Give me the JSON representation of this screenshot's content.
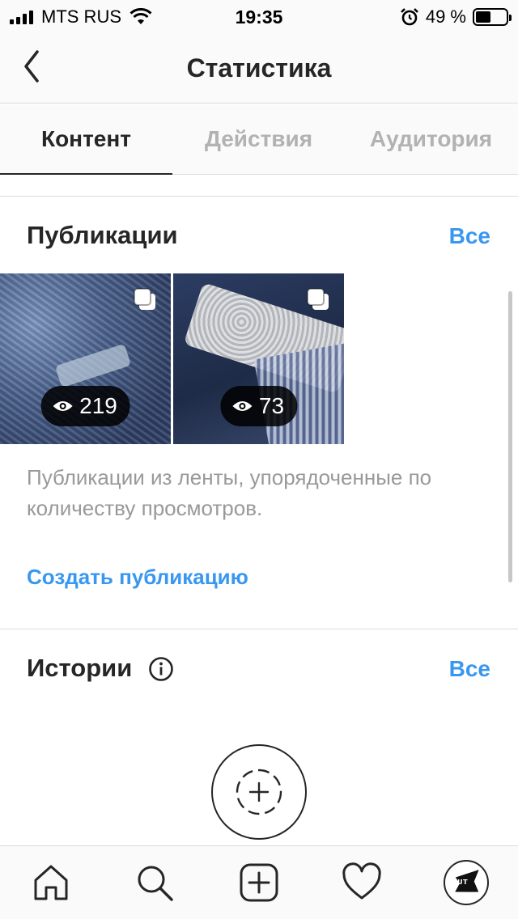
{
  "status_bar": {
    "carrier": "MTS RUS",
    "time": "19:35",
    "battery_percent": "49 %",
    "battery_level": 0.49
  },
  "nav": {
    "title": "Статистика",
    "back_icon": "chevron-left-icon"
  },
  "tabs": [
    {
      "label": "Контент",
      "active": true
    },
    {
      "label": "Действия",
      "active": false
    },
    {
      "label": "Аудитория",
      "active": false
    }
  ],
  "publications": {
    "title": "Публикации",
    "see_all": "Все",
    "posts": [
      {
        "views": "219",
        "type_icon": "carousel-icon"
      },
      {
        "views": "73",
        "type_icon": "carousel-icon"
      }
    ],
    "description": "Публикации из ленты, упорядоченные по количеству просмотров.",
    "create_link": "Создать публикацию"
  },
  "stories": {
    "title": "Истории",
    "see_all": "Все",
    "info_icon": "info-icon",
    "add_icon": "add-story-icon"
  },
  "tab_bar": {
    "items": [
      "home-icon",
      "search-icon",
      "new-post-icon",
      "activity-heart-icon",
      "profile-avatar"
    ],
    "profile_logo_text": "DUT"
  },
  "colors": {
    "accent": "#3897f0",
    "text": "#262626",
    "muted": "#999999",
    "inactive_tab": "#b2b2b2"
  }
}
